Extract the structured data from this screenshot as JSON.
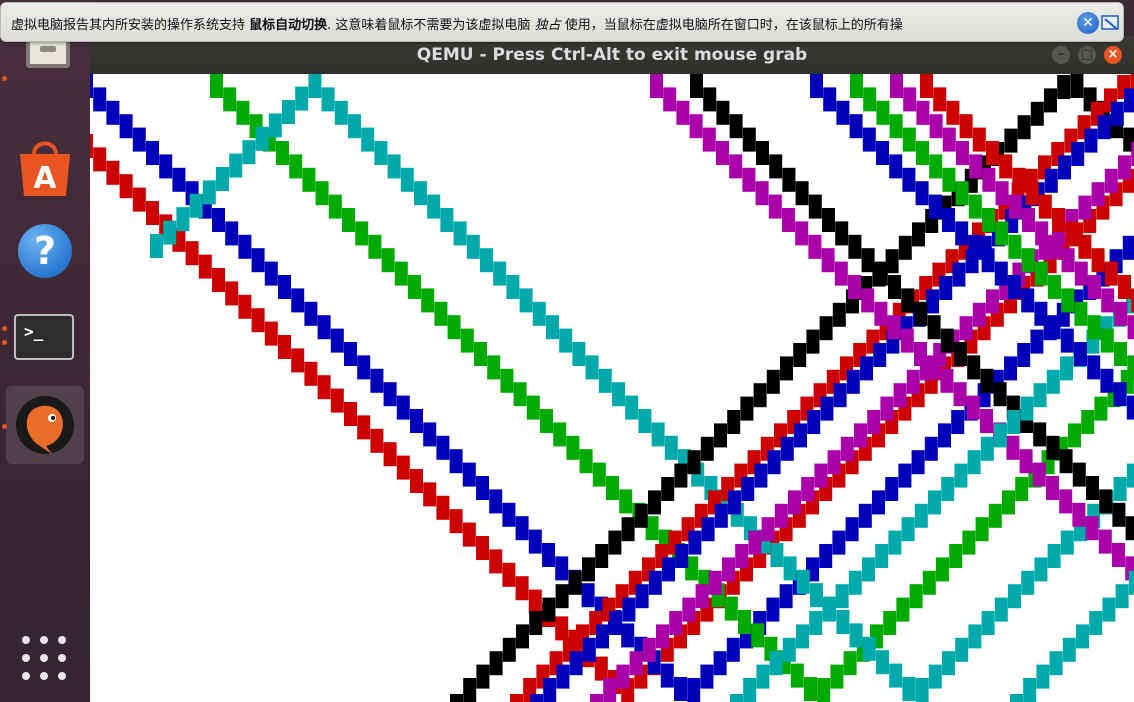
{
  "notification": {
    "text_before": "虚拟电脑报告其内所安装的操作系统支持 ",
    "bold": "鼠标自动切换",
    "text_mid": ". 这意味着鼠标不需要为该虚拟电脑 ",
    "italic": "独占",
    "text_after": " 使用，当鼠标在虚拟电脑所在窗口时，在该鼠标上的所有操"
  },
  "window": {
    "title": "QEMU - Press Ctrl-Alt to exit mouse grab"
  },
  "dock": {
    "items": [
      "files-icon",
      "software-icon",
      "help-icon",
      "terminal-icon",
      "qemu-icon"
    ],
    "apps_grid": "show-apps-icon"
  },
  "colors": {
    "red": "#cc0000",
    "green": "#00aa00",
    "blue": "#0000bb",
    "cyan": "#00aaaa",
    "magenta": "#aa00aa",
    "black": "#000000",
    "orange": "#b85c00",
    "accent": "#e95420"
  }
}
